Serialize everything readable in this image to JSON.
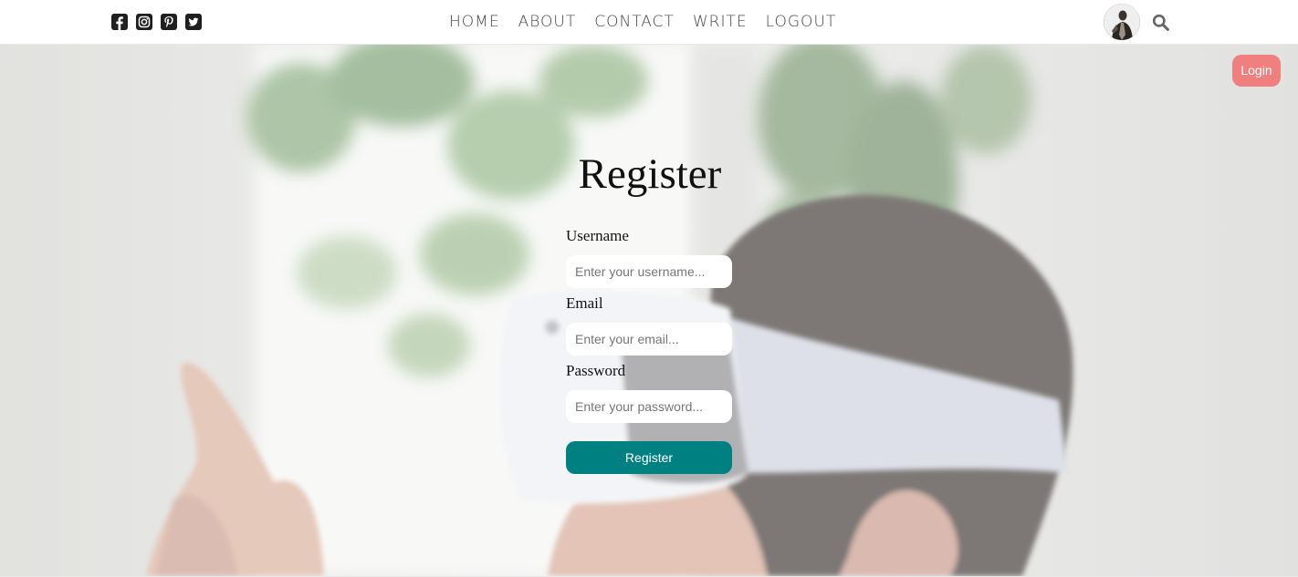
{
  "social": {
    "icons": [
      "facebook-square-icon",
      "instagram-square-icon",
      "pinterest-square-icon",
      "twitter-square-icon"
    ]
  },
  "nav": {
    "items": [
      "HOME",
      "ABOUT",
      "CONTACT",
      "WRITE",
      "LOGOUT"
    ]
  },
  "header": {
    "avatar_icon": "user-avatar",
    "search_icon": "search-icon"
  },
  "hero": {
    "login_label": "Login",
    "title": "Register",
    "username_label": "Username",
    "username_placeholder": "Enter your username...",
    "email_label": "Email",
    "email_placeholder": "Enter your email...",
    "password_label": "Password",
    "password_placeholder": "Enter your password...",
    "register_label": "Register"
  },
  "colors": {
    "login_button": "#f08080",
    "register_button": "#008080",
    "nav_text": "#444444"
  }
}
